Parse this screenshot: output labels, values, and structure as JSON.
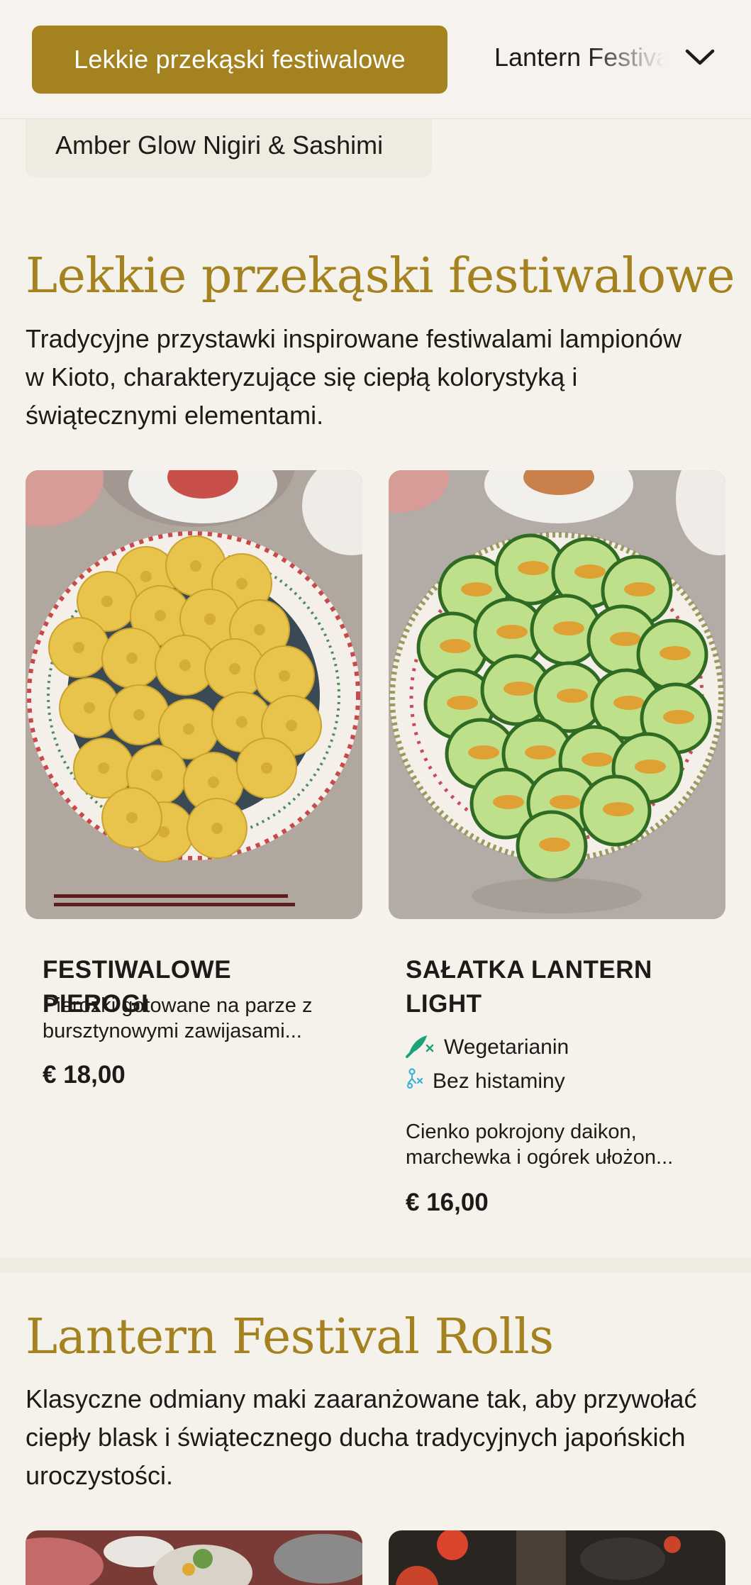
{
  "category_bar": {
    "active_label": "Lekkie przekąski festiwalowe",
    "next_label": "Lantern Festival Rolls"
  },
  "subcategory_chip": "Amber Glow Nigiri & Sashimi",
  "sections": [
    {
      "title": "Lekkie przekąski festiwalowe",
      "description": "Tradycyjne przystawki inspirowane festiwalami lampionów w Kioto, charakteryzujące się ciepłą kolorystyką i świątecznymi elementami.",
      "items": [
        {
          "name": "FESTIWALOWE PIEROGI",
          "description": "Pierożki gotowane na parze z bursztynowymi zawijasami...",
          "price": "€ 18,00",
          "image_icon": "dumplings-plate-photo"
        },
        {
          "name": "SAŁATKA LANTERN LIGHT",
          "tags": [
            {
              "label": "Wegetarianin",
              "icon": "vegetarian-icon",
              "color": "#1aa37a"
            },
            {
              "label": "Bez histaminy",
              "icon": "histamine-free-icon",
              "color": "#3bb3d6"
            }
          ],
          "description": "Cienko pokrojony daikon, marchewka i ogórek ułożon...",
          "price": "€ 16,00",
          "image_icon": "cucumber-salad-photo"
        }
      ]
    },
    {
      "title": "Lantern Festival Rolls",
      "description": "Klasyczne odmiany maki zaaranżowane tak, aby przywołać ciepły blask i świątecznego ducha tradycyjnych japońskich uroczystości."
    }
  ],
  "colors": {
    "accent": "#a3821f",
    "background": "#f5f2ec",
    "chip": "#efebe0",
    "text": "#1d1b17"
  }
}
